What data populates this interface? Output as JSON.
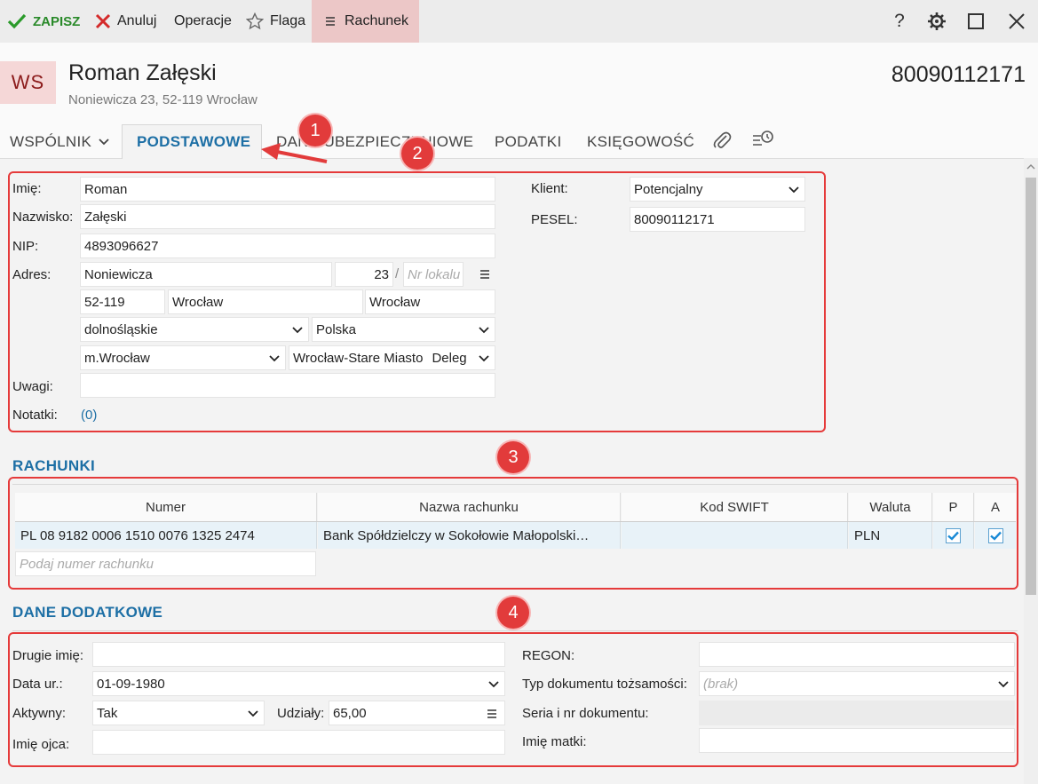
{
  "toolbar": {
    "save_label": "ZAPISZ",
    "cancel_label": "Anuluj",
    "operations_label": "Operacje",
    "flag_label": "Flaga",
    "account_label": "Rachunek",
    "help_glyph": "?"
  },
  "header": {
    "avatar_initials": "WS",
    "name": "Roman Załęski",
    "address": "Noniewicza 23, 52-119 Wrocław",
    "id_number": "80090112171"
  },
  "tabs": {
    "wspolnik": "WSPÓLNIK",
    "podstawowe": "PODSTAWOWE",
    "dane_ubezpieczeniowe": "DANE UBEZPIECZENIOWE",
    "podatki": "PODATKI",
    "ksiegowosc": "KSIĘGOWOŚĆ"
  },
  "basic": {
    "imie_label": "Imię:",
    "imie": "Roman",
    "nazwisko_label": "Nazwisko:",
    "nazwisko": "Załęski",
    "nip_label": "NIP:",
    "nip": "4893096627",
    "adres_label": "Adres:",
    "street": "Noniewicza",
    "house_no": "23",
    "slash": "/",
    "flat_placeholder": "Nr lokalu",
    "postal": "52-119",
    "city": "Wrocław",
    "post_office": "Wrocław",
    "voivodeship": "dolnośląskie",
    "country": "Polska",
    "county": "m.Wrocław",
    "district": "Wrocław-Stare Miasto",
    "district_type": "Deleg",
    "uwagi_label": "Uwagi:",
    "uwagi": "",
    "notatki_label": "Notatki:",
    "notatki_link": "(0)",
    "klient_label": "Klient:",
    "klient": "Potencjalny",
    "pesel_label": "PESEL:",
    "pesel": "80090112171"
  },
  "accounts": {
    "title": "RACHUNKI",
    "columns": [
      "Numer",
      "Nazwa rachunku",
      "Kod SWIFT",
      "Waluta",
      "P",
      "A"
    ],
    "rows": [
      {
        "numer": "PL 08 9182 0006 1510 0076 1325 2474",
        "nazwa": "Bank Spółdzielczy w Sokołowie Małopolski…",
        "swift": "",
        "waluta": "PLN",
        "p": true,
        "a": true
      }
    ],
    "new_placeholder": "Podaj numer rachunku"
  },
  "extra": {
    "title": "DANE DODATKOWE",
    "drugie_imie_label": "Drugie imię:",
    "drugie_imie": "",
    "data_ur_label": "Data ur.:",
    "data_ur": "01-09-1980",
    "aktywny_label": "Aktywny:",
    "aktywny": "Tak",
    "udzialy_label": "Udziały:",
    "udzialy": "65,00",
    "imie_ojca_label": "Imię ojca:",
    "imie_ojca": "",
    "regon_label": "REGON:",
    "regon": "",
    "typ_dok_label": "Typ dokumentu tożsamości:",
    "typ_dok_placeholder": "(brak)",
    "seria_label": "Seria i nr dokumentu:",
    "seria": "",
    "imie_matki_label": "Imię matki:",
    "imie_matki": ""
  },
  "annotations": {
    "badge1": "1",
    "badge2": "2",
    "badge3": "3",
    "badge4": "4"
  },
  "colors": {
    "accent": "#1d6fa5",
    "save_green": "#2a9a2a",
    "cancel_red": "#d42a2a",
    "annotation_red": "#e23b3b"
  }
}
